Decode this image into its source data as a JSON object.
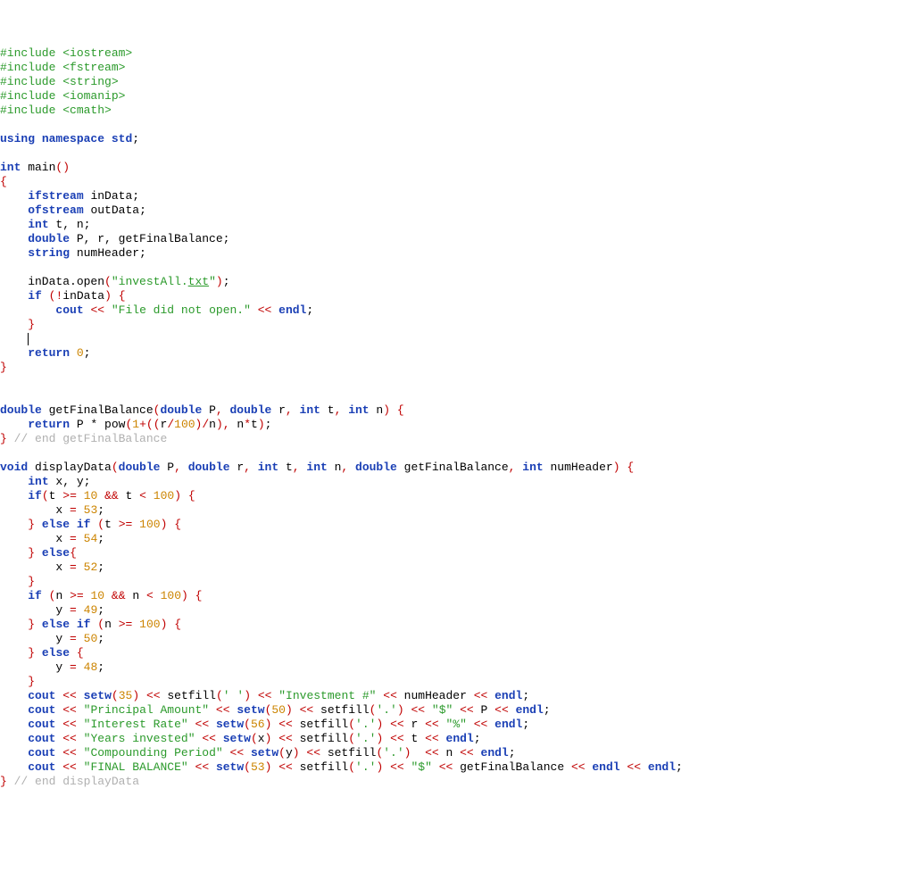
{
  "include1": "#include <iostream>",
  "include2": "#include <fstream>",
  "include3": "#include <string>",
  "include4": "#include <iomanip>",
  "include5": "#include <cmath>",
  "using_kw": "using",
  "namespace_kw": "namespace",
  "std_name": "std",
  "semi": ";",
  "int_kw": "int",
  "main_name": " main",
  "lparen": "(",
  "rparen": ")",
  "lbrace": "{",
  "rbrace": "}",
  "ifstream_kw": "ifstream",
  "inData_decl": " inData",
  "ofstream_kw": "ofstream",
  "outData_decl": " outData",
  "tn_decl": " t, n",
  "double_kw": "double",
  "Pr_decl": " P, r, getFinalBalance",
  "string_kw": "string",
  "numHeader_decl": " numHeader",
  "inData_open_pre": "    inData.open",
  "q1": "\"",
  "file_p1": "investAll.",
  "file_p2": "txt",
  "if_kw": "if",
  "not_op": "!",
  "inData_check": "inData",
  "cout_kw": "cout",
  "ll": "<<",
  "fileerr_str": "\"File did not open.\"",
  "endl_kw": "endl",
  "return_kw": "return",
  "zero": "0",
  "getFinalBalance_name": " getFinalBalance",
  "comma": ",",
  "P_param": " P",
  "r_param": " r",
  "t_param": " t",
  "n_param": " n",
  "pow_expr_pre": " P * pow",
  "one": "1",
  "plus": "+",
  "r_var": "r",
  "slash": "/",
  "hundred": "100",
  "n_var": "n",
  "star": "*",
  "t_var": "t",
  "comment_gfb": " // end getFinalBalance",
  "void_kw": "void",
  "displayData_name": " displayData",
  "gfb_param": " getFinalBalance",
  "nh_param": " numHeader",
  "xy_decl": " x, y",
  "ge": ">=",
  "lt": "<",
  "ten": "10",
  "amp": "&&",
  "x_assign": "x ",
  "y_assign": "y ",
  "eq": "=",
  "n53": "53",
  "n54": "54",
  "n52": "52",
  "n49": "49",
  "n50": "50",
  "n48": "48",
  "n35": "35",
  "n56": "56",
  "else_kw": "else",
  "setw_kw": "setw",
  "setfill_name": " setfill",
  "sp_char": "' '",
  "dot_char": "'.'",
  "inv_str": "\"Investment #\"",
  "numHeader_var": " numHeader ",
  "prin_str": "\"Principal Amount\"",
  "dollar_str": "\"$\"",
  "P_var": " P ",
  "int_rate_str": "\"Interest Rate\"",
  "r_out": " r ",
  "pct_str": "\"%\"",
  "years_str": "\"Years invested\"",
  "x_var": "x",
  "t_out": " t ",
  "comp_str": "\"Compounding Period\"",
  "y_var": "y",
  "n_out": " n ",
  "final_str": "\"FINAL BALANCE\"",
  "gfb_out": " getFinalBalance ",
  "comment_dd": " // end displayData",
  "sp": " "
}
